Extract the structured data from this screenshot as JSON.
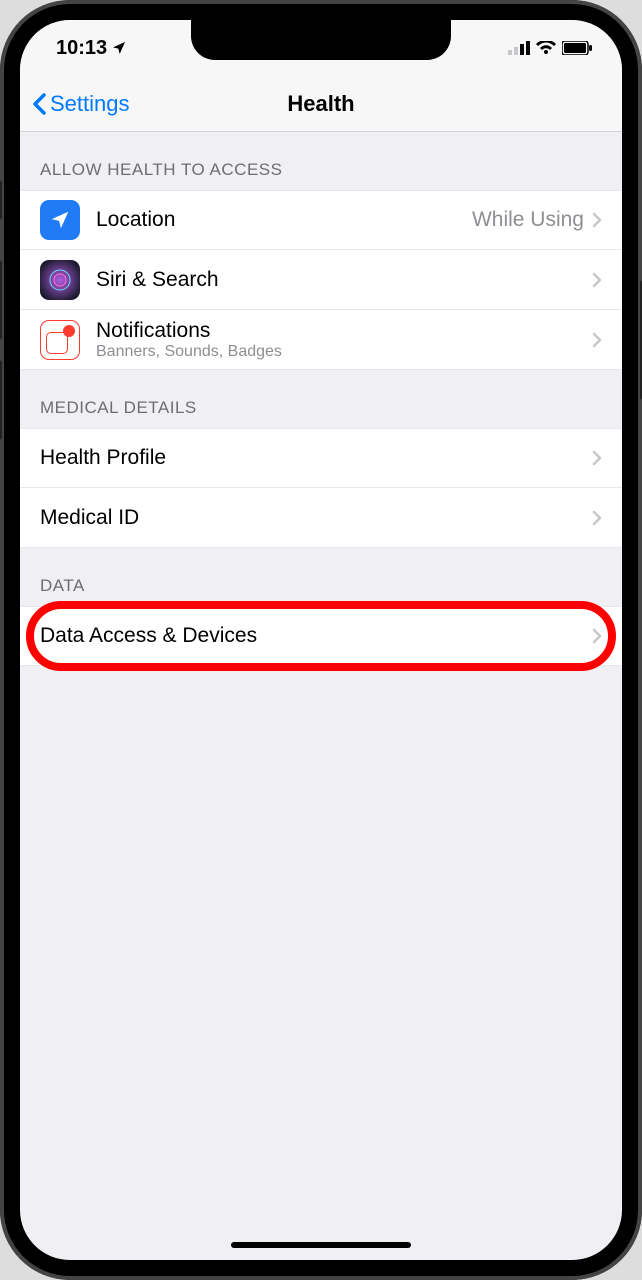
{
  "status": {
    "time": "10:13",
    "locationGlyph": "➤"
  },
  "nav": {
    "back": "Settings",
    "title": "Health"
  },
  "sections": {
    "access": {
      "header": "ALLOW HEALTH TO ACCESS",
      "location": {
        "label": "Location",
        "value": "While Using"
      },
      "siri": {
        "label": "Siri & Search"
      },
      "notifications": {
        "label": "Notifications",
        "sub": "Banners, Sounds, Badges"
      }
    },
    "medical": {
      "header": "MEDICAL DETAILS",
      "profile": {
        "label": "Health Profile"
      },
      "medicalId": {
        "label": "Medical ID"
      }
    },
    "data": {
      "header": "DATA",
      "access": {
        "label": "Data Access & Devices"
      }
    }
  }
}
